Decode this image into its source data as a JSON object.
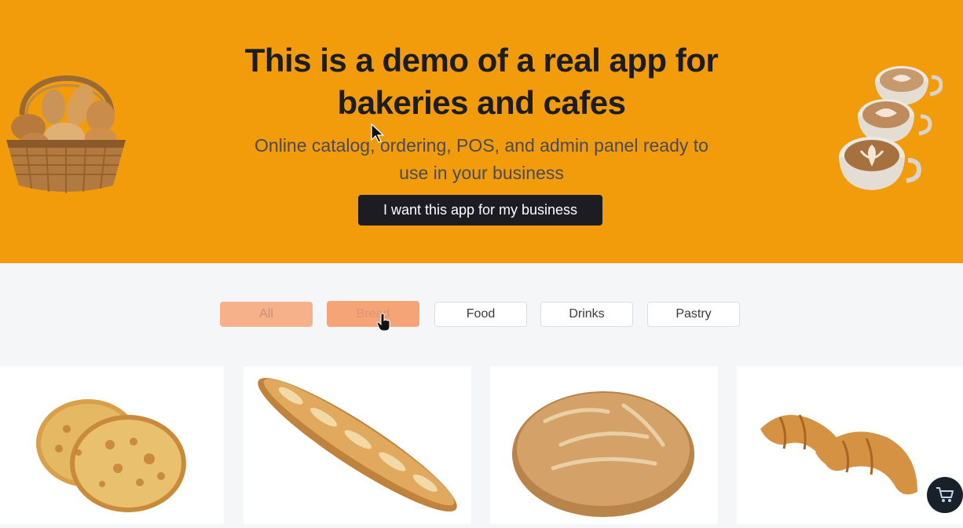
{
  "hero": {
    "title_line1": "This is a demo of a real app for",
    "title_line2": "bakeries and cafes",
    "subtitle_line1": "Online catalog, ordering, POS, and admin panel ready to",
    "subtitle_line2": "use in your business",
    "cta_label": "I want this app for my business",
    "decor_left": "bread-basket-image",
    "decor_right": "coffee-cups-image"
  },
  "filters": {
    "items": [
      {
        "label": "All",
        "state": "selected"
      },
      {
        "label": "Bread",
        "state": "hovered"
      },
      {
        "label": "Food",
        "state": "default"
      },
      {
        "label": "Drinks",
        "state": "default"
      },
      {
        "label": "Pastry",
        "state": "default"
      }
    ]
  },
  "products": [
    {
      "image": "cheese-buns-image"
    },
    {
      "image": "baguette-image"
    },
    {
      "image": "round-loaf-image"
    },
    {
      "image": "croissants-image"
    }
  ],
  "cart": {
    "icon": "cart-icon"
  },
  "colors": {
    "hero_bg": "#f29c0c",
    "page_bg": "#f5f6f8",
    "cta_bg": "#1c1c22",
    "chip_selected": "#f6b08a",
    "chip_hover": "#f4a476",
    "cart_bg": "#18202a"
  }
}
